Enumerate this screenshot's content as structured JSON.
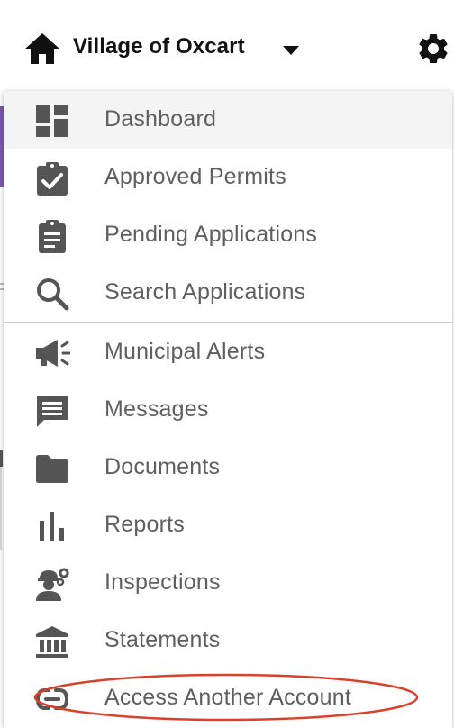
{
  "header": {
    "title": "Village of Oxcart",
    "icons": {
      "home": "home-icon",
      "dropdown": "caret-down-icon",
      "settings": "gear-icon"
    }
  },
  "menu": {
    "items": [
      {
        "label": "Dashboard",
        "icon": "dashboard-icon",
        "active": true
      },
      {
        "label": "Approved Permits",
        "icon": "clipboard-check-icon"
      },
      {
        "label": "Pending Applications",
        "icon": "clipboard-text-icon"
      },
      {
        "label": "Search Applications",
        "icon": "search-icon"
      },
      {
        "label": "Municipal Alerts",
        "icon": "megaphone-icon"
      },
      {
        "label": "Messages",
        "icon": "message-icon"
      },
      {
        "label": "Documents",
        "icon": "folder-icon"
      },
      {
        "label": "Reports",
        "icon": "bar-chart-icon"
      },
      {
        "label": "Inspections",
        "icon": "inspector-icon"
      },
      {
        "label": "Statements",
        "icon": "bank-icon"
      },
      {
        "label": "Access Another Account",
        "icon": "link-icon",
        "highlighted": true
      }
    ]
  },
  "colors": {
    "icon": "#555555",
    "label": "#5f5f5f",
    "active_bg": "#f4f4f4",
    "highlight": "#d9412b",
    "accent_purple": "#7a5bb0"
  }
}
